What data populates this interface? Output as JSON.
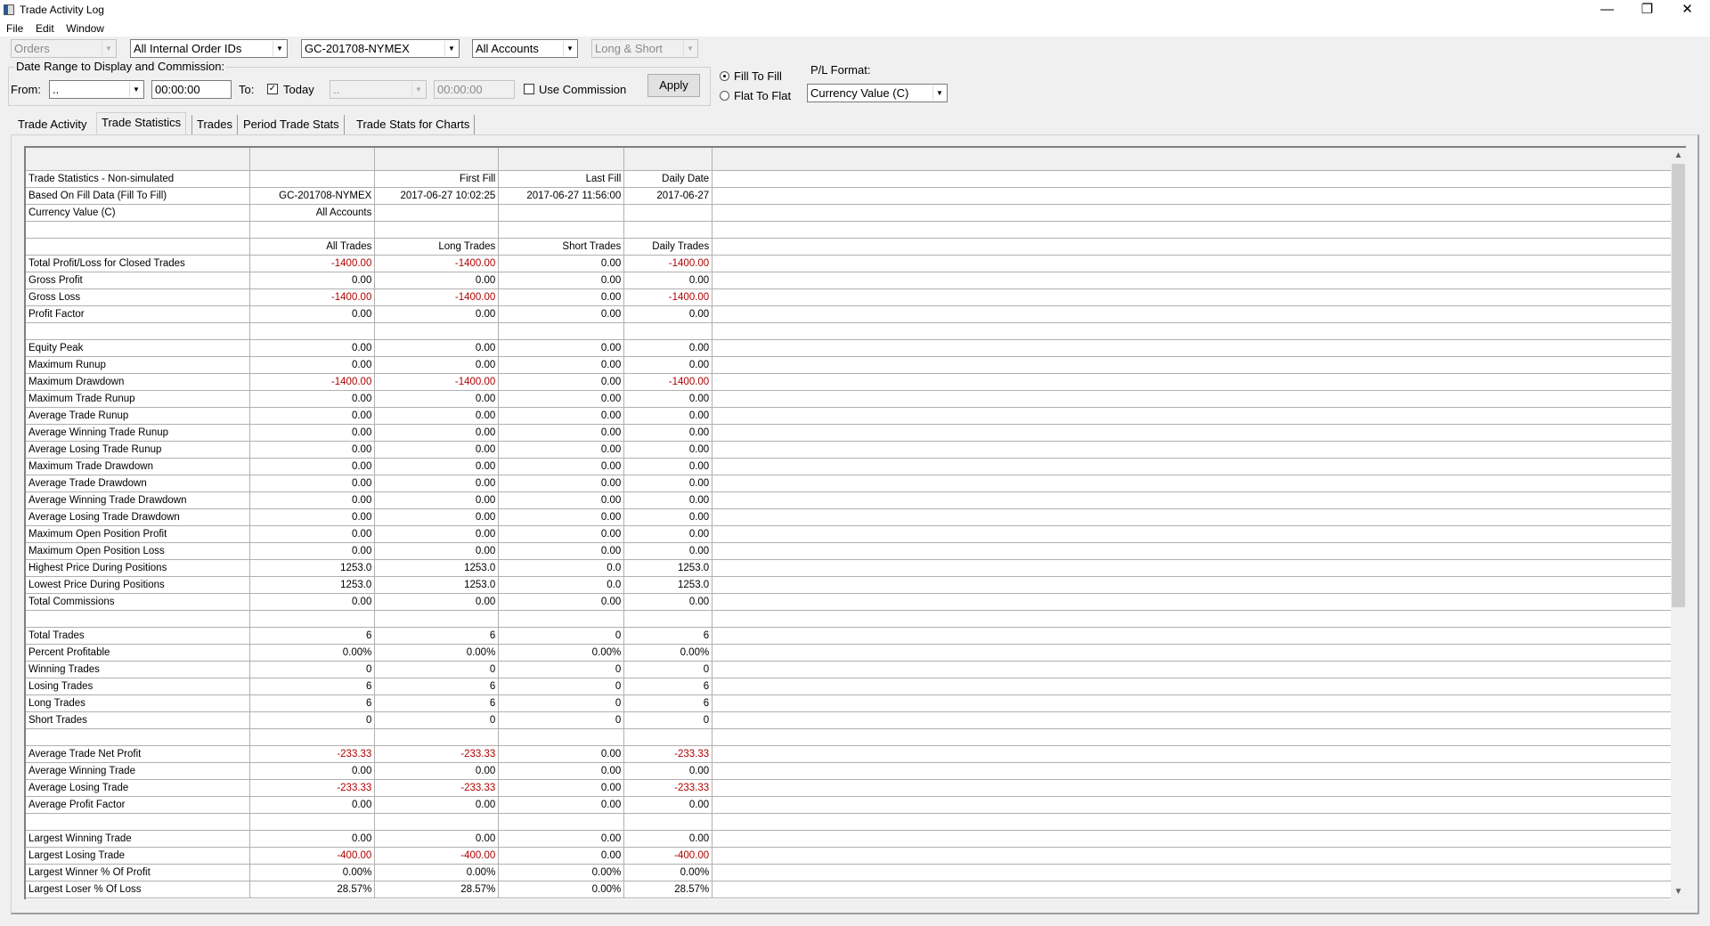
{
  "window": {
    "title": "Trade Activity Log",
    "minimize": "—",
    "restore": "❐",
    "close": "✕"
  },
  "menu": [
    "File",
    "Edit",
    "Window"
  ],
  "filters": {
    "type": "Orders",
    "order_ids": "All Internal Order IDs",
    "symbol": "GC-201708-NYMEX",
    "accounts": "All Accounts",
    "side": "Long & Short"
  },
  "date_range": {
    "group_label": "Date Range to Display and Commission:",
    "from_label": "From:",
    "from_date": "..",
    "from_time": "00:00:00",
    "to_label": "To:",
    "today_checked": true,
    "today_label": "Today",
    "to_date": "..",
    "to_time": "00:00:00",
    "use_commission_label": "Use Commission",
    "use_commission_checked": false,
    "apply_label": "Apply"
  },
  "fill_mode": {
    "options": [
      "Fill To Fill",
      "Flat To Flat"
    ],
    "selected": 0
  },
  "pl_format": {
    "label": "P/L Format:",
    "value": "Currency Value (C)"
  },
  "tabs": [
    {
      "label": "Trade Activity"
    },
    {
      "label": "Trade Statistics",
      "selected": true
    },
    {
      "label": "Trades"
    },
    {
      "label": "Period Trade Stats"
    },
    {
      "label": "Trade Stats for Charts"
    }
  ],
  "colors": {
    "negative": "#b00000"
  },
  "stats_rows": [
    [
      "Trade Statistics - Non-simulated",
      "",
      "First Fill",
      "Last Fill",
      "Daily Date"
    ],
    [
      "Based On Fill Data (Fill To Fill)",
      "GC-201708-NYMEX",
      "2017-06-27  10:02:25",
      "2017-06-27  11:56:00",
      "2017-06-27"
    ],
    [
      "Currency Value (C)",
      "All Accounts",
      "",
      "",
      ""
    ],
    [
      "",
      "",
      "",
      "",
      ""
    ],
    [
      "",
      "All Trades",
      "Long Trades",
      "Short Trades",
      "Daily Trades"
    ],
    [
      "Total Profit/Loss for Closed Trades",
      "-1400.00",
      "-1400.00",
      "0.00",
      "-1400.00"
    ],
    [
      "Gross Profit",
      "0.00",
      "0.00",
      "0.00",
      "0.00"
    ],
    [
      "Gross Loss",
      "-1400.00",
      "-1400.00",
      "0.00",
      "-1400.00"
    ],
    [
      "Profit Factor",
      "0.00",
      "0.00",
      "0.00",
      "0.00"
    ],
    [
      "",
      "",
      "",
      "",
      ""
    ],
    [
      "Equity Peak",
      "0.00",
      "0.00",
      "0.00",
      "0.00"
    ],
    [
      "Maximum Runup",
      "0.00",
      "0.00",
      "0.00",
      "0.00"
    ],
    [
      "Maximum Drawdown",
      "-1400.00",
      "-1400.00",
      "0.00",
      "-1400.00"
    ],
    [
      "Maximum Trade Runup",
      "0.00",
      "0.00",
      "0.00",
      "0.00"
    ],
    [
      "Average Trade Runup",
      "0.00",
      "0.00",
      "0.00",
      "0.00"
    ],
    [
      "Average Winning Trade Runup",
      "0.00",
      "0.00",
      "0.00",
      "0.00"
    ],
    [
      "Average Losing Trade Runup",
      "0.00",
      "0.00",
      "0.00",
      "0.00"
    ],
    [
      "Maximum Trade Drawdown",
      "0.00",
      "0.00",
      "0.00",
      "0.00"
    ],
    [
      "Average Trade Drawdown",
      "0.00",
      "0.00",
      "0.00",
      "0.00"
    ],
    [
      "Average Winning Trade Drawdown",
      "0.00",
      "0.00",
      "0.00",
      "0.00"
    ],
    [
      "Average Losing Trade Drawdown",
      "0.00",
      "0.00",
      "0.00",
      "0.00"
    ],
    [
      "Maximum Open Position Profit",
      "0.00",
      "0.00",
      "0.00",
      "0.00"
    ],
    [
      "Maximum Open Position Loss",
      "0.00",
      "0.00",
      "0.00",
      "0.00"
    ],
    [
      "Highest Price During Positions",
      "1253.0",
      "1253.0",
      "0.0",
      "1253.0"
    ],
    [
      "Lowest Price During Positions",
      "1253.0",
      "1253.0",
      "0.0",
      "1253.0"
    ],
    [
      "Total Commissions",
      "0.00",
      "0.00",
      "0.00",
      "0.00"
    ],
    [
      "",
      "",
      "",
      "",
      ""
    ],
    [
      "Total Trades",
      "6",
      "6",
      "0",
      "6"
    ],
    [
      "Percent Profitable",
      "0.00%",
      "0.00%",
      "0.00%",
      "0.00%"
    ],
    [
      "Winning Trades",
      "0",
      "0",
      "0",
      "0"
    ],
    [
      "Losing Trades",
      "6",
      "6",
      "0",
      "6"
    ],
    [
      "Long Trades",
      "6",
      "6",
      "0",
      "6"
    ],
    [
      "Short Trades",
      "0",
      "0",
      "0",
      "0"
    ],
    [
      "",
      "",
      "",
      "",
      ""
    ],
    [
      "Average Trade Net Profit",
      "-233.33",
      "-233.33",
      "0.00",
      "-233.33"
    ],
    [
      "Average Winning Trade",
      "0.00",
      "0.00",
      "0.00",
      "0.00"
    ],
    [
      "Average Losing Trade",
      "-233.33",
      "-233.33",
      "0.00",
      "-233.33"
    ],
    [
      "Average Profit Factor",
      "0.00",
      "0.00",
      "0.00",
      "0.00"
    ],
    [
      "",
      "",
      "",
      "",
      ""
    ],
    [
      "Largest Winning Trade",
      "0.00",
      "0.00",
      "0.00",
      "0.00"
    ],
    [
      "Largest Losing Trade",
      "-400.00",
      "-400.00",
      "0.00",
      "-400.00"
    ],
    [
      "Largest Winner % Of Profit",
      "0.00%",
      "0.00%",
      "0.00%",
      "0.00%"
    ],
    [
      "Largest Loser % Of Loss",
      "28.57%",
      "28.57%",
      "0.00%",
      "28.57%"
    ]
  ]
}
